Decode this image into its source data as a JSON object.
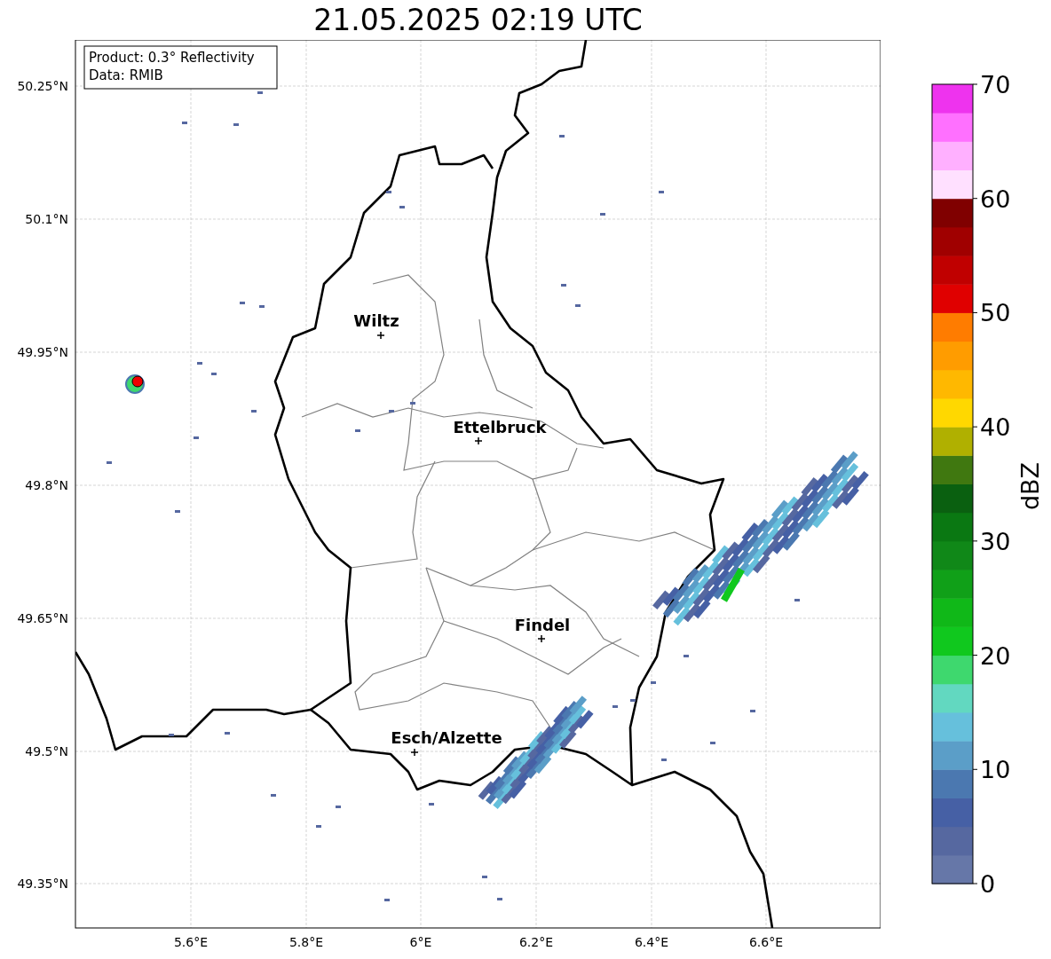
{
  "title": "21.05.2025 02:19 UTC",
  "info_box": [
    "Product: 0.3° Reflectivity",
    "Data: RMIB"
  ],
  "map": {
    "lat_ticks": [
      "50.25°N",
      "50.1°N",
      "49.95°N",
      "49.8°N",
      "49.65°N",
      "49.5°N",
      "49.35°N"
    ],
    "lon_ticks": [
      "5.6°E",
      "5.8°E",
      "6°E",
      "6.2°E",
      "6.4°E",
      "6.6°E"
    ],
    "places": [
      {
        "name": "Wiltz"
      },
      {
        "name": "Ettelbruck"
      },
      {
        "name": "Findel"
      },
      {
        "name": "Esch/Alzette"
      }
    ]
  },
  "colorbar": {
    "label": "dBZ",
    "ticks": [
      "70",
      "60",
      "50",
      "40",
      "30",
      "20",
      "10",
      "0"
    ]
  }
}
